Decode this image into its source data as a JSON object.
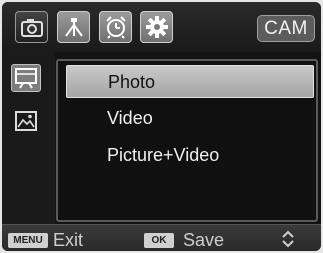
{
  "tabs": [
    {
      "icon": "camera-icon",
      "active": true
    },
    {
      "icon": "tripod-icon",
      "active": false
    },
    {
      "icon": "alarm-clock-icon",
      "active": false
    },
    {
      "icon": "gear-icon",
      "active": false
    }
  ],
  "mode_badge": "CAM",
  "sidebar": [
    {
      "icon": "photo-frame-icon",
      "active": true
    },
    {
      "icon": "image-gallery-icon",
      "active": false
    }
  ],
  "menu": {
    "selected_index": 0,
    "items": [
      "Photo",
      "Video",
      "Picture+Video"
    ]
  },
  "footer": {
    "exit_key": "MENU",
    "exit_label": "Exit",
    "save_key": "OK",
    "save_label": "Save",
    "nav_icon": "up-down-arrows-icon"
  }
}
